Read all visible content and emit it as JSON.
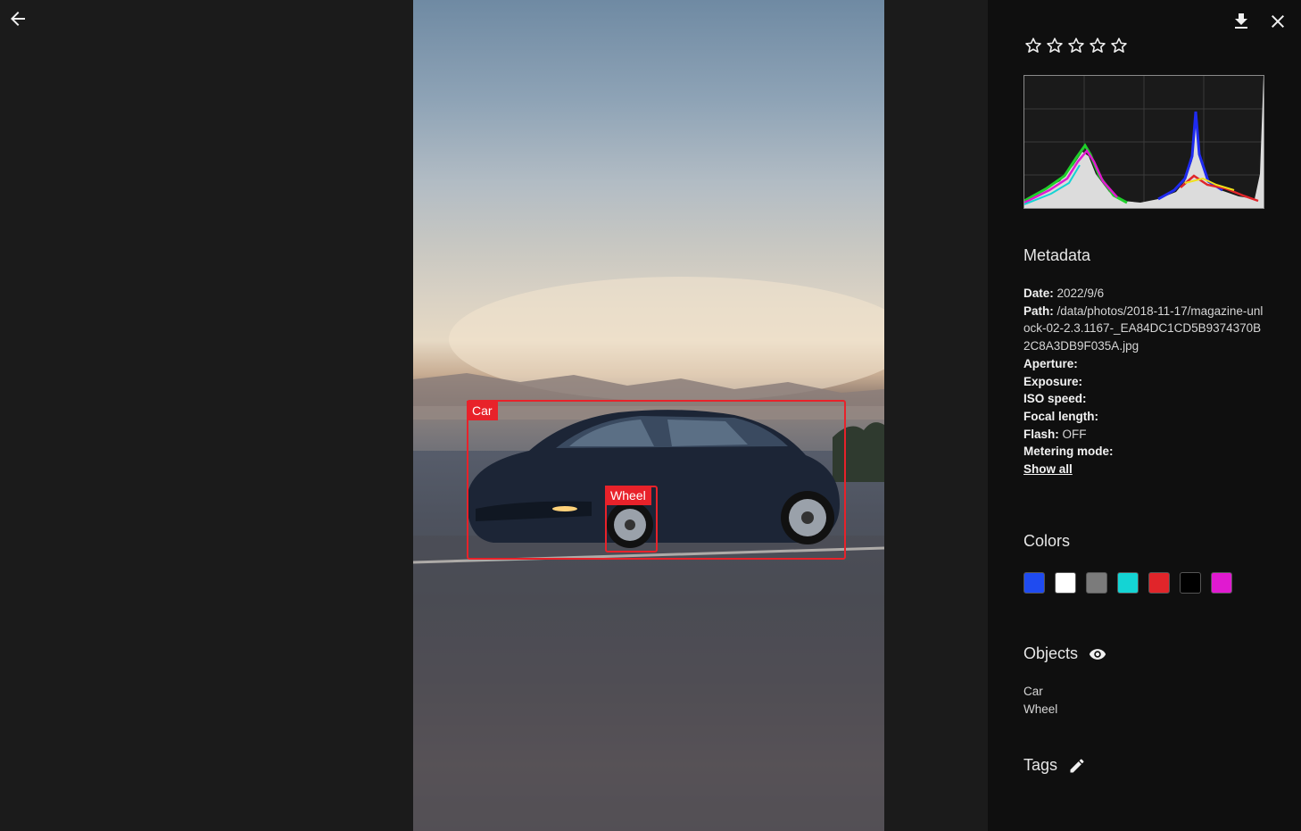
{
  "icons": {
    "back": "arrow-left-icon",
    "download": "download-icon",
    "close": "close-icon",
    "objects_toggle": "eye-icon",
    "tags_edit": "pencil-icon"
  },
  "photo": {
    "detections": [
      {
        "label": "Car"
      },
      {
        "label": "Wheel"
      }
    ]
  },
  "rating": {
    "value": 0,
    "max": 5
  },
  "metadata": {
    "title": "Metadata",
    "date_label": "Date:",
    "date": "2022/9/6",
    "path_label": "Path:",
    "path": "/data/photos/2018-11-17/magazine-unlock-02-2.3.1167-_EA84DC1CD5B9374370B2C8A3DB9F035A.jpg",
    "aperture_label": "Aperture:",
    "exposure_label": "Exposure:",
    "iso_label": "ISO speed:",
    "focal_label": "Focal length:",
    "flash_label": "Flash:",
    "flash": "OFF",
    "metering_label": "Metering mode:",
    "show_all": "Show all"
  },
  "colors": {
    "title": "Colors",
    "swatches": [
      "#1f4bf0",
      "#ffffff",
      "#7b7b7b",
      "#14d4d4",
      "#e0252a",
      "#000000",
      "#e01ad0"
    ]
  },
  "objects": {
    "title": "Objects",
    "items": [
      "Car",
      "Wheel"
    ]
  },
  "tags": {
    "title": "Tags"
  },
  "theme": {
    "accent": "#e8222a",
    "panel_bg": "#0f0f0f",
    "viewer_bg": "#1b1b1b"
  }
}
